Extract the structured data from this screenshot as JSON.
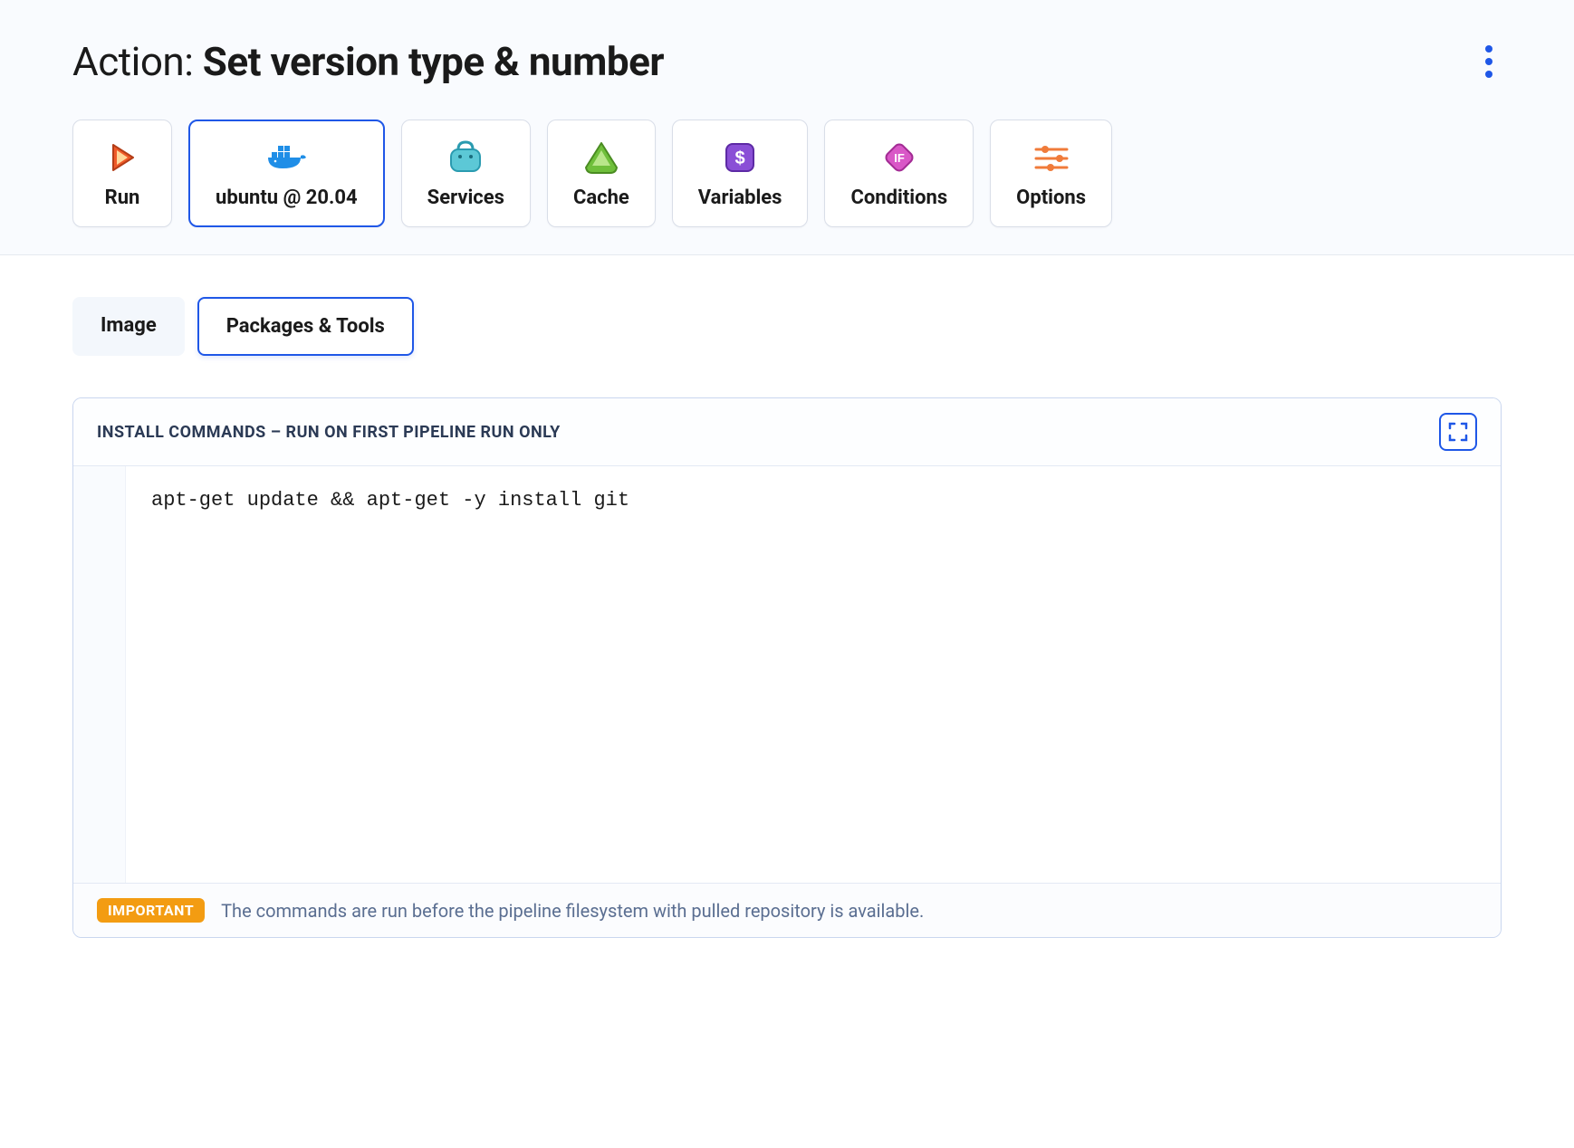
{
  "header": {
    "title_prefix": "Action: ",
    "title_main": "Set version type & number"
  },
  "nav_tabs": [
    {
      "id": "run",
      "label": "Run"
    },
    {
      "id": "ubuntu",
      "label": "ubuntu @ 20.04"
    },
    {
      "id": "services",
      "label": "Services"
    },
    {
      "id": "cache",
      "label": "Cache"
    },
    {
      "id": "variables",
      "label": "Variables"
    },
    {
      "id": "conditions",
      "label": "Conditions"
    },
    {
      "id": "options",
      "label": "Options"
    }
  ],
  "active_nav_tab": "ubuntu",
  "sub_tabs": [
    {
      "id": "image",
      "label": "Image"
    },
    {
      "id": "packages",
      "label": "Packages & Tools"
    }
  ],
  "active_sub_tab": "packages",
  "editor": {
    "heading": "INSTALL COMMANDS – RUN ON FIRST PIPELINE RUN ONLY",
    "code": "apt-get update && apt-get -y install git",
    "footer_badge": "IMPORTANT",
    "footer_text": "The commands are run before the pipeline filesystem with pulled repository is available."
  },
  "icons": {
    "run": "play-icon",
    "ubuntu": "docker-icon",
    "services": "bag-icon",
    "cache": "triangle-icon",
    "variables": "dollar-icon",
    "conditions": "if-diamond-icon",
    "options": "sliders-icon"
  }
}
